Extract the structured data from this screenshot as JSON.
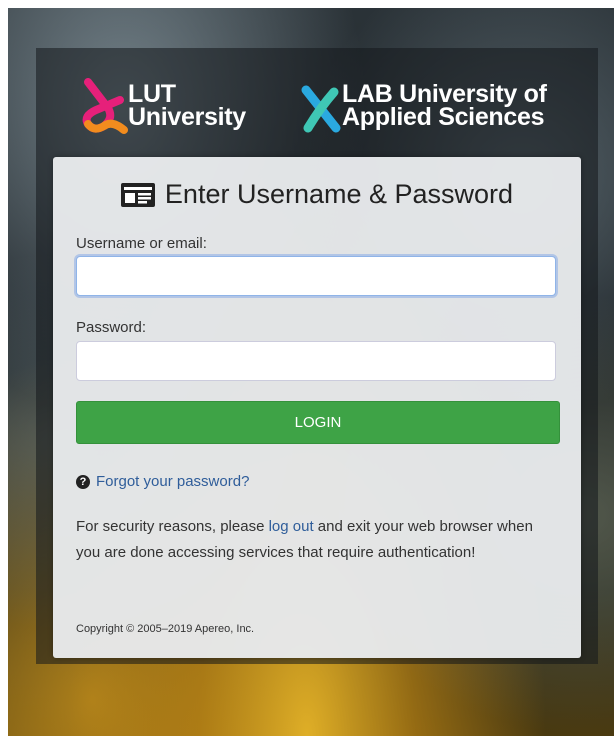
{
  "header": {
    "lut_logo": {
      "line1": "LUT",
      "line2": "University"
    },
    "lab_logo": {
      "line1": "LAB University of",
      "line2": "Applied Sciences"
    }
  },
  "form": {
    "title": "Enter Username & Password",
    "title_icon": "id-card-icon",
    "username_label": "Username or email:",
    "username_value": "",
    "password_label": "Password:",
    "password_value": "",
    "login_label": "LOGIN",
    "forgot_label": "Forgot your password?",
    "forgot_icon": "question-circle-icon"
  },
  "notice": {
    "before": "For security reasons, please ",
    "link": "log out",
    "after": " and exit your web browser when you are done accessing services that require authentication!"
  },
  "footer": {
    "copyright": "Copyright © 2005–2019 Apereo, Inc."
  },
  "colors": {
    "login_button": "#3ea346",
    "link": "#2f5d9a",
    "lut_orange": "#f28c1e",
    "lut_pink": "#e6207a",
    "lab_blue": "#2aa9e0",
    "lab_teal": "#3fc7b5"
  }
}
